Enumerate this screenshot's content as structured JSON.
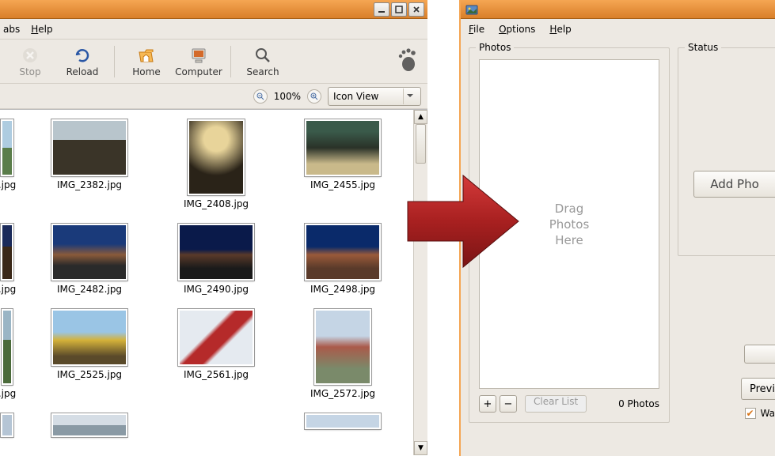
{
  "nautilus": {
    "menus": {
      "tabs": "abs",
      "help": "Help"
    },
    "toolbar": {
      "stop": "Stop",
      "reload": "Reload",
      "home": "Home",
      "computer": "Computer",
      "search": "Search"
    },
    "zoom_level": "100%",
    "view_mode": "Icon View",
    "files": [
      {
        "name": ".jpg"
      },
      {
        "name": "IMG_2382.jpg"
      },
      {
        "name": "IMG_2408.jpg"
      },
      {
        "name": "IMG_2455.jpg"
      },
      {
        "name": ".jpg"
      },
      {
        "name": "IMG_2482.jpg"
      },
      {
        "name": "IMG_2490.jpg"
      },
      {
        "name": "IMG_2498.jpg"
      },
      {
        "name": ".jpg"
      },
      {
        "name": "IMG_2525.jpg"
      },
      {
        "name": "IMG_2561.jpg"
      },
      {
        "name": "IMG_2572.jpg"
      }
    ]
  },
  "uploader": {
    "menus": {
      "file": "File",
      "options": "Options",
      "help": "Help"
    },
    "photos_label": "Photos",
    "status_label": "Status",
    "drop_line1": "Drag",
    "drop_line2": "Photos",
    "drop_line3": "Here",
    "add_label": "Add Pho",
    "clear_label": "Clear List",
    "count_label": "0 Photos",
    "preview_label": "Previ",
    "check_label": "Wa"
  }
}
